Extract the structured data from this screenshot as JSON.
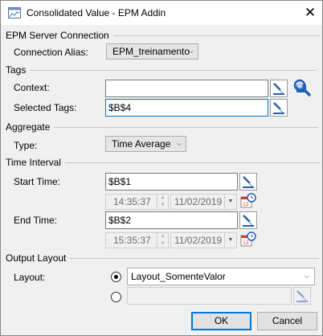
{
  "window": {
    "title": "Consolidated Value - EPM Addin",
    "close_glyph": "✕"
  },
  "epm_server": {
    "section_label": "EPM Server Connection",
    "alias_label": "Connection Alias:",
    "alias_value": "EPM_treinamento"
  },
  "tags": {
    "section_label": "Tags",
    "context_label": "Context:",
    "context_value": "",
    "selected_label": "Selected Tags:",
    "selected_value": "$B$4"
  },
  "aggregate": {
    "section_label": "Aggregate",
    "type_label": "Type:",
    "type_value": "Time Average"
  },
  "time_interval": {
    "section_label": "Time Interval",
    "start_label": "Start Time:",
    "start_value": "$B$1",
    "start_time": "14:35:37",
    "start_date": "11/02/2019",
    "end_label": "End Time:",
    "end_value": "$B$2",
    "end_time": "15:35:37",
    "end_date": "11/02/2019"
  },
  "output_layout": {
    "section_label": "Output Layout",
    "layout_label": "Layout:",
    "layout_value": "Layout_SomenteValor",
    "custom_value": ""
  },
  "buttons": {
    "ok": "OK",
    "cancel": "Cancel"
  },
  "colors": {
    "accent": "#0078d7",
    "background": "#f0f0f0",
    "calendar_red": "#d83b2a"
  },
  "icons": [
    "app-chart-icon",
    "close-icon",
    "tag-picker-icon",
    "tag-search-icon",
    "chevron-down-icon",
    "calendar-clock-icon",
    "spin-up-icon",
    "spin-down-icon"
  ]
}
